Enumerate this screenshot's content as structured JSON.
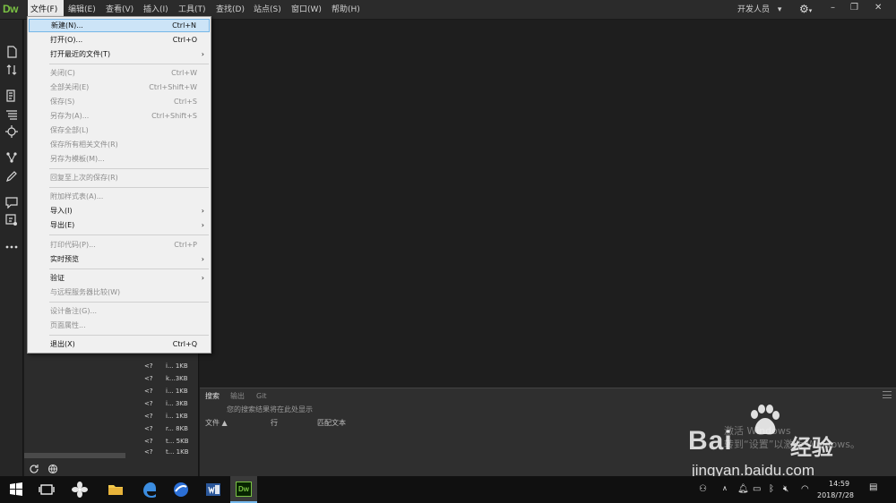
{
  "app": {
    "logo": "Dw"
  },
  "menubar": {
    "items": [
      "文件(F)",
      "编辑(E)",
      "查看(V)",
      "插入(I)",
      "工具(T)",
      "查找(D)",
      "站点(S)",
      "窗口(W)",
      "帮助(H)"
    ],
    "workspace": "开发人员",
    "workspace_arrow": "▾",
    "window_minimize": "–",
    "window_restore": "❐",
    "window_close": "✕"
  },
  "file_menu": {
    "items": [
      {
        "label": "新建(N)...",
        "shortcut": "Ctrl+N"
      },
      {
        "label": "打开(O)...",
        "shortcut": "Ctrl+O"
      },
      {
        "label": "打开最近的文件(T)",
        "arrow": "›"
      },
      {
        "label": "关闭(C)",
        "shortcut": "Ctrl+W"
      },
      {
        "label": "全部关闭(E)",
        "shortcut": "Ctrl+Shift+W"
      },
      {
        "label": "保存(S)",
        "shortcut": "Ctrl+S"
      },
      {
        "label": "另存为(A)...",
        "shortcut": "Ctrl+Shift+S"
      },
      {
        "label": "保存全部(L)"
      },
      {
        "label": "保存所有相关文件(R)"
      },
      {
        "label": "另存为模板(M)..."
      },
      {
        "label": "回复至上次的保存(R)"
      },
      {
        "label": "附加样式表(A)..."
      },
      {
        "label": "导入(I)",
        "arrow": "›"
      },
      {
        "label": "导出(E)",
        "arrow": "›"
      },
      {
        "label": "打印代码(P)...",
        "shortcut": "Ctrl+P"
      },
      {
        "label": "实时预览",
        "arrow": "›"
      },
      {
        "label": "验证",
        "arrow": "›"
      },
      {
        "label": "与远程服务器比较(W)"
      },
      {
        "label": "设计备注(G)..."
      },
      {
        "label": "页面属性..."
      },
      {
        "label": "退出(X)",
        "shortcut": "Ctrl+Q"
      }
    ]
  },
  "file_panel": {
    "rows": [
      {
        "ext": "<?",
        "size": "i... 1KB"
      },
      {
        "ext": "<?",
        "size": "k...3KB"
      },
      {
        "ext": "<?",
        "size": "i... 1KB"
      },
      {
        "ext": "<?",
        "size": "i... 3KB"
      },
      {
        "ext": "<?",
        "size": "i... 1KB"
      },
      {
        "ext": "<?",
        "size": "r... 8KB"
      },
      {
        "ext": "<?",
        "size": "t... 5KB"
      },
      {
        "ext": "<?",
        "size": "t... 1KB"
      }
    ]
  },
  "bottom_panel": {
    "tabs": [
      "搜索",
      "输出",
      "Git"
    ],
    "hint": "您的搜索结果将在此处显示",
    "columns": [
      "文件 ▲",
      "行",
      "匹配文本"
    ]
  },
  "watermark": {
    "activation_line1": "激活 Windows",
    "activation_line2": "转到“设置”以激活 Windows。",
    "brand_left": "Bai",
    "brand_right": "经验",
    "url": "jingyan.baidu.com"
  },
  "taskbar": {
    "dw_label": "Dw",
    "time": "14:59",
    "date": "2018/7/28"
  },
  "colors": {
    "accent_dw": "#7ac143",
    "menu_highlight": "#cce4f7",
    "taskbar_active": "#76b9ed"
  }
}
